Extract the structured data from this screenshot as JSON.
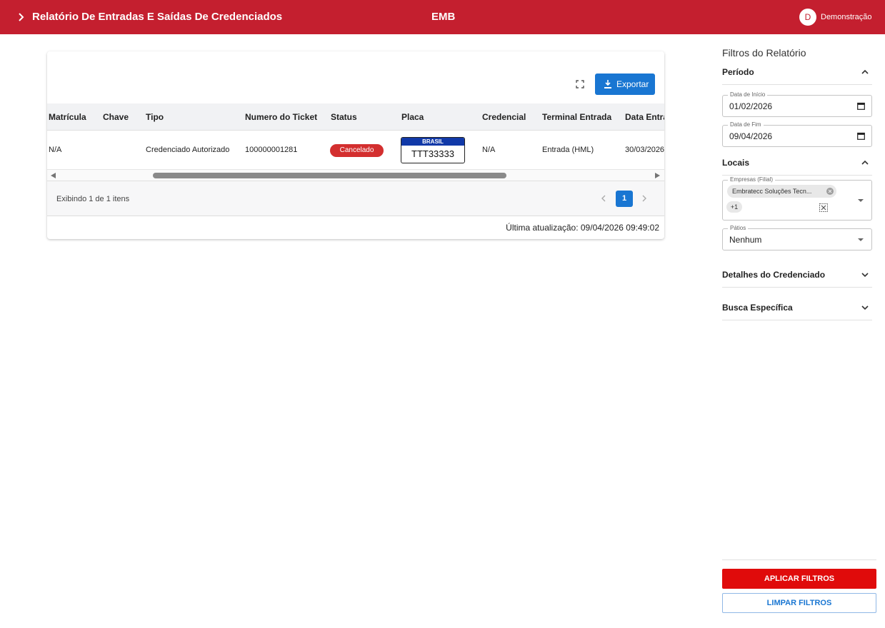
{
  "header": {
    "title": "Relatório De Entradas E Saídas De Credenciados",
    "brand": "EMB",
    "user_initial": "D",
    "user_name": "Demonstração",
    "background_color": "#c41f2f"
  },
  "table_card": {
    "export_label": "Exportar",
    "columns": [
      "Matrícula",
      "Chave",
      "Tipo",
      "Numero do Ticket",
      "Status",
      "Placa",
      "Credencial",
      "Terminal Entrada",
      "Data Entra"
    ],
    "rows": [
      {
        "matricula": "N/A",
        "chave": "",
        "tipo": "Credenciado Autorizado",
        "ticket": "100000001281",
        "status": "Cancelado",
        "placa_country": "BRASIL",
        "placa_number": "TTT33333",
        "credencial": "N/A",
        "terminal_entrada": "Entrada (HML)",
        "data_entrada": "30/03/2026"
      }
    ],
    "footer_info": "Exibindo 1 de 1 itens",
    "current_page": "1",
    "last_update": "Última atualização: 09/04/2026 09:49:02"
  },
  "filters": {
    "title": "Filtros do Relatório",
    "periodo": {
      "label": "Período",
      "start_label": "Data de Início",
      "start_value": "01/02/2026",
      "end_label": "Data de Fim",
      "end_value": "09/04/2026"
    },
    "locais": {
      "label": "Locais",
      "empresas_label": "Empresas (Filial)",
      "empresas_chip": "Embratecc Soluções Tecn...",
      "empresas_more": "+1",
      "patios_label": "Pátios",
      "patios_value": "Nenhum"
    },
    "detalhes_label": "Detalhes do Credenciado",
    "busca_label": "Busca Específica",
    "apply_label": "APLICAR FILTROS",
    "clear_label": "LIMPAR FILTROS"
  }
}
